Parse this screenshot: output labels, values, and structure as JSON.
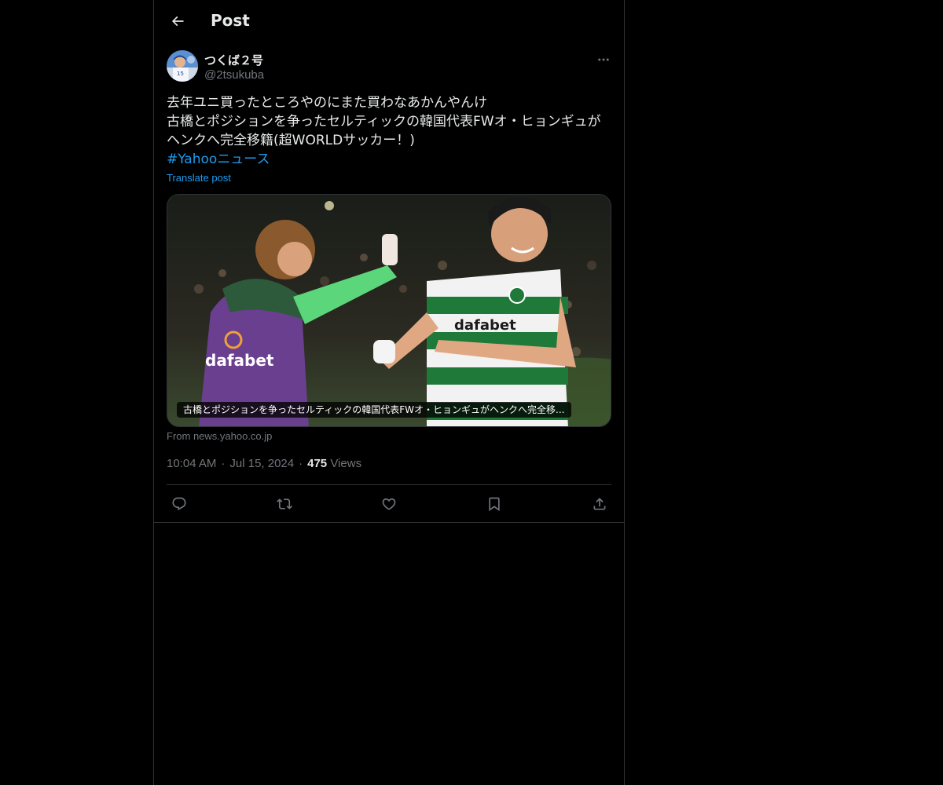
{
  "header": {
    "title": "Post",
    "back_icon": "arrow-left-icon"
  },
  "author": {
    "name": "つくば２号",
    "handle": "@2tsukuba",
    "avatar": "baseball-player-avatar"
  },
  "post": {
    "lines": [
      "去年ユニ買ったところやのにまた買わなあかんやんけ",
      "古橋とポジションを争ったセルティックの韓国代表FWオ・ヒョンギュが",
      "ヘンクへ完全移籍(超WORLDサッカー！)"
    ],
    "hashtag": "#Yahooニュース",
    "translate_label": "Translate post"
  },
  "card": {
    "caption": "古橋とポジションを争ったセルティックの韓国代表FWオ・ヒョンギュがヘンクへ完全移...",
    "source": "From news.yahoo.co.jp",
    "image": "soccer-celebration-photo"
  },
  "meta": {
    "time": "10:04 AM",
    "date": "Jul 15, 2024",
    "views_count": "475",
    "views_label": "Views"
  },
  "actions": [
    {
      "name": "reply-icon"
    },
    {
      "name": "repost-icon"
    },
    {
      "name": "like-icon"
    },
    {
      "name": "bookmark-icon"
    },
    {
      "name": "share-icon"
    }
  ],
  "colors": {
    "background": "#000000",
    "text": "#e7e9ea",
    "secondary": "#71767b",
    "link": "#1d9bf0",
    "border": "#2f3336"
  }
}
